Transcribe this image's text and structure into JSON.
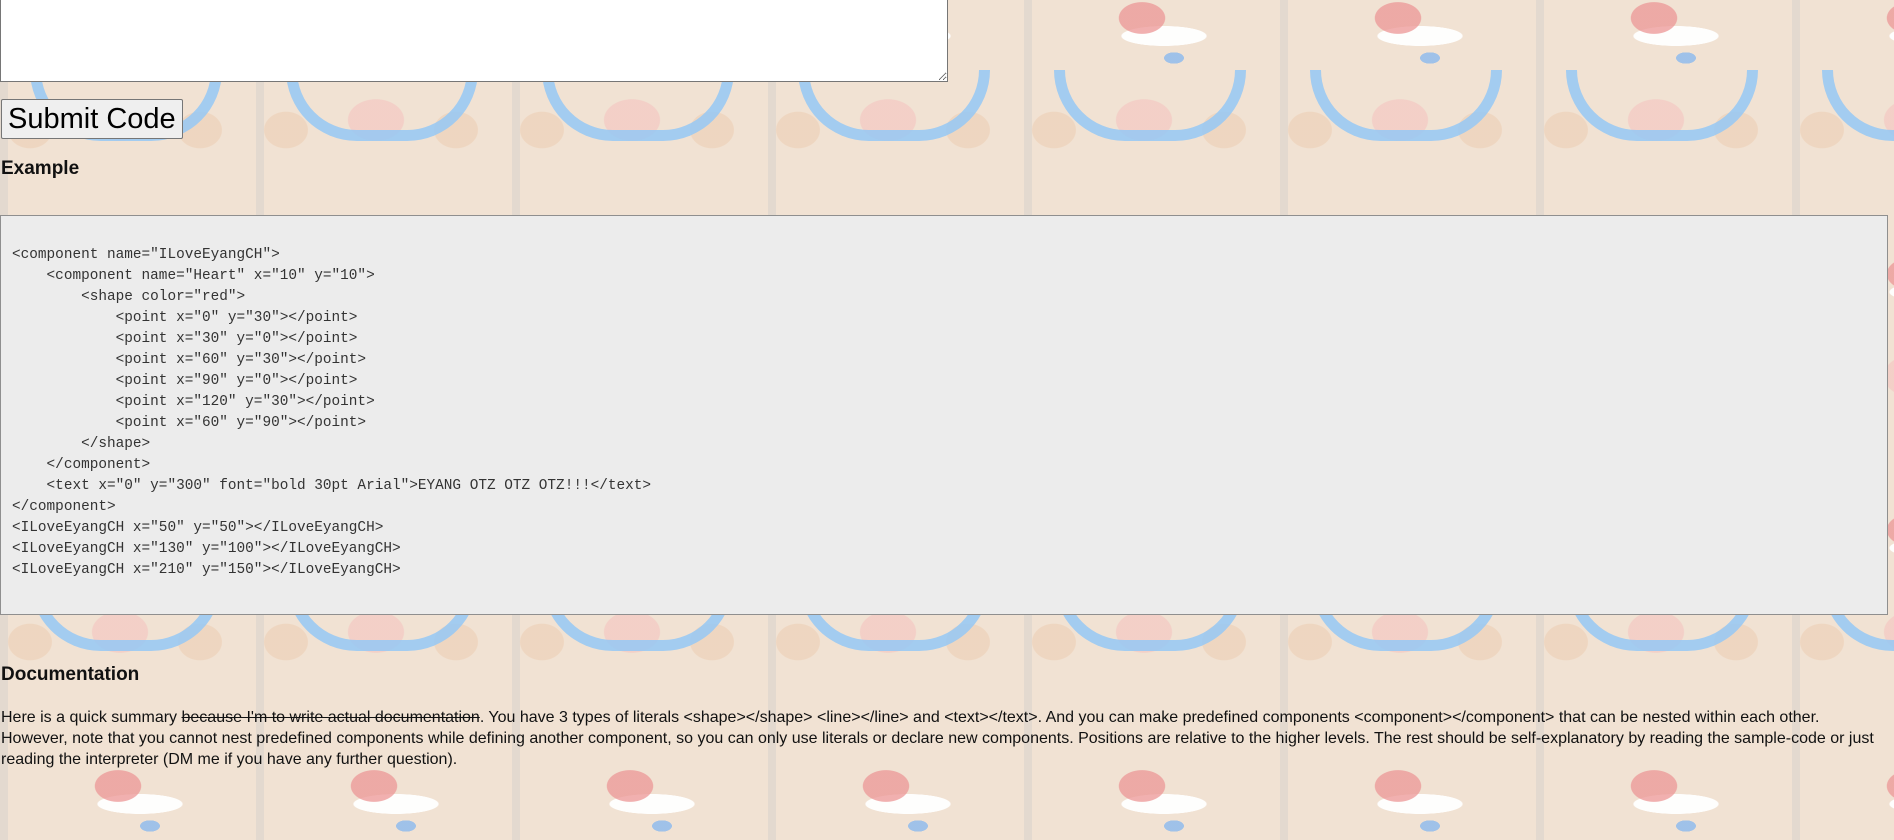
{
  "code_input": {
    "value": ""
  },
  "submit_button": {
    "label": "Submit Code"
  },
  "example": {
    "heading": "Example",
    "code": "<component name=\"ILoveEyangCH\">\n    <component name=\"Heart\" x=\"10\" y=\"10\">\n        <shape color=\"red\">\n            <point x=\"0\" y=\"30\"></point>\n            <point x=\"30\" y=\"0\"></point>\n            <point x=\"60\" y=\"30\"></point>\n            <point x=\"90\" y=\"0\"></point>\n            <point x=\"120\" y=\"30\"></point>\n            <point x=\"60\" y=\"90\"></point>\n        </shape>\n    </component>\n    <text x=\"0\" y=\"300\" font=\"bold 30pt Arial\">EYANG OTZ OTZ OTZ!!!</text>\n</component>\n<ILoveEyangCH x=\"50\" y=\"50\"></ILoveEyangCH>\n<ILoveEyangCH x=\"130\" y=\"100\"></ILoveEyangCH>\n<ILoveEyangCH x=\"210\" y=\"150\"></ILoveEyangCH>"
  },
  "documentation": {
    "heading": "Documentation",
    "intro": "Here is a quick summary ",
    "struck": "because I'm to write actual documentation",
    "body": ". You have 3 types of literals <shape></shape> <line></line> and <text></text>. And you can make predefined components <component></component> that can be nested within each other. However, note that you cannot nest predefined components while defining another component, so you can only use literals or declare new components. Positions are relative to the higher levels. The rest should be self-explanatory by reading the sample-code or just reading the interpreter (DM me if you have any further question)."
  },
  "background": {
    "image_description": "cat-santa-hat-tile"
  }
}
